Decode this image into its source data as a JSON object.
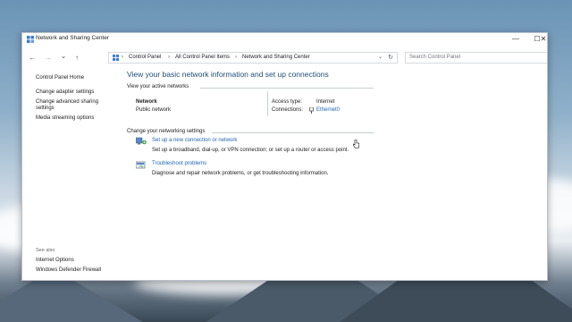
{
  "window": {
    "title": "Network and Sharing Center",
    "controls": {
      "minimize": "—",
      "maximize": "☐",
      "close": "✕"
    }
  },
  "nav": {
    "back": "←",
    "forward": "→",
    "history": "⌄",
    "up": "↑"
  },
  "address": {
    "crumbs": [
      "Control Panel",
      "All Control Panel Items",
      "Network and Sharing Center"
    ],
    "separator": "›"
  },
  "search": {
    "placeholder": "Search Control Panel"
  },
  "sidebar": {
    "items": [
      {
        "label": "Control Panel Home"
      },
      {
        "label": "Change adapter settings"
      },
      {
        "label": "Change advanced sharing settings"
      },
      {
        "label": "Media streaming options"
      }
    ],
    "see_also_heading": "See also",
    "see_also": [
      {
        "label": "Internet Options"
      },
      {
        "label": "Windows Defender Firewall"
      }
    ]
  },
  "main": {
    "heading": "View your basic network information and set up connections",
    "active_networks_label": "View your active networks",
    "network": {
      "name": "Network",
      "category": "Public network",
      "access_type_label": "Access type:",
      "access_type_value": "Internet",
      "connections_label": "Connections:",
      "connections_value": "Ethernet0"
    },
    "change_settings_label": "Change your networking settings",
    "tasks": [
      {
        "title": "Set up a new connection or network",
        "desc": "Set up a broadband, dial-up, or VPN connection; or set up a router or access point."
      },
      {
        "title": "Troubleshoot problems",
        "desc": "Diagnose and repair network problems, or get troubleshooting information."
      }
    ]
  },
  "colors": {
    "link": "#2266b5",
    "heading": "#1f4e79"
  }
}
